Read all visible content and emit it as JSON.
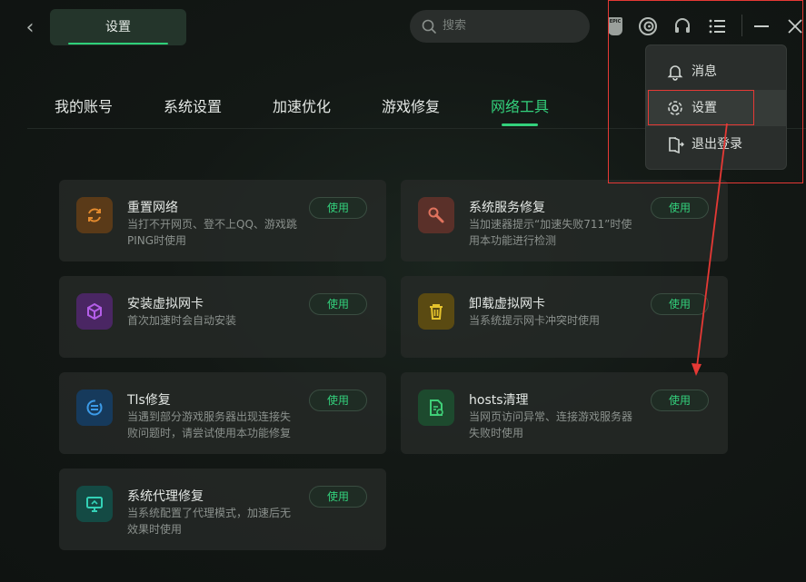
{
  "header": {
    "title_tab": "设置",
    "search_placeholder": "搜索",
    "epic_text": "EPIC"
  },
  "nav": {
    "tabs": [
      "我的账号",
      "系统设置",
      "加速优化",
      "游戏修复",
      "网络工具"
    ],
    "active_index": 4
  },
  "tools": [
    {
      "title": "重置网络",
      "desc": "当打不开网页、登不上QQ、游戏跳PING时使用",
      "button": "使用",
      "icon": "refresh-icon",
      "color": "#e38a2e"
    },
    {
      "title": "系统服务修复",
      "desc": "当加速器提示“加速失败711”时使用本功能进行检测",
      "button": "使用",
      "icon": "wrench-icon",
      "color": "#e0735e"
    },
    {
      "title": "安装虚拟网卡",
      "desc": "首次加速时会自动安装",
      "button": "使用",
      "icon": "cube-icon",
      "color": "#b45ee8"
    },
    {
      "title": "卸载虚拟网卡",
      "desc": "当系统提示网卡冲突时使用",
      "button": "使用",
      "icon": "trash-icon",
      "color": "#e5c32c"
    },
    {
      "title": "Tls修复",
      "desc": "当遇到部分游戏服务器出现连接失败问题时，请尝试使用本功能修复",
      "button": "使用",
      "icon": "sync-icon",
      "color": "#3c9be8"
    },
    {
      "title": "hosts清理",
      "desc": "当网页访问异常、连接游戏服务器失败时使用",
      "button": "使用",
      "icon": "file-clean-icon",
      "color": "#3fcf78"
    },
    {
      "title": "系统代理修复",
      "desc": "当系统配置了代理模式，加速后无效果时使用",
      "button": "使用",
      "icon": "monitor-icon",
      "color": "#33d1b6"
    }
  ],
  "menu": {
    "items": [
      {
        "label": "消息",
        "icon": "bell-icon"
      },
      {
        "label": "设置",
        "icon": "gear-icon"
      },
      {
        "label": "退出登录",
        "icon": "logout-icon"
      }
    ],
    "highlighted_index": 1
  },
  "colors": {
    "accent": "#33d17c",
    "annotation": "#e53935"
  }
}
